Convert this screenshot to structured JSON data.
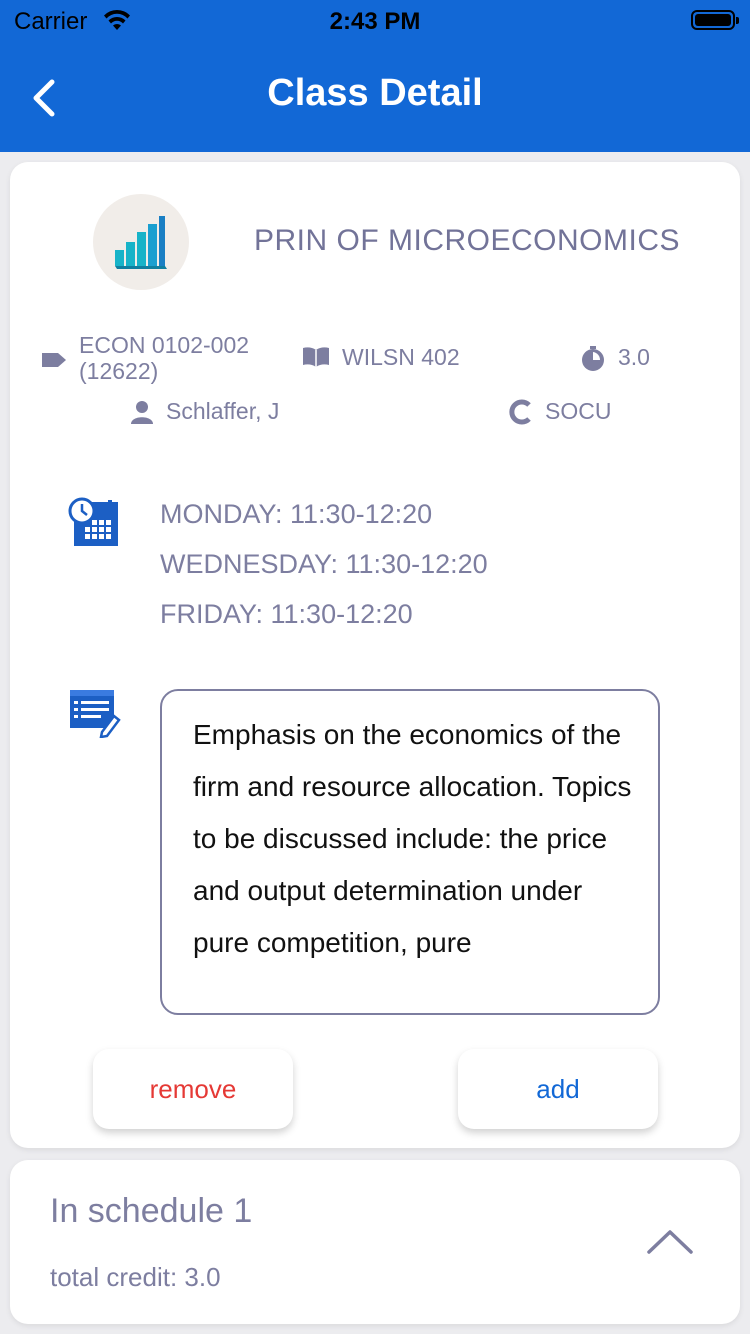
{
  "status_bar": {
    "carrier": "Carrier",
    "time": "2:43 PM"
  },
  "nav": {
    "title": "Class Detail",
    "back_icon": "chevron-left-icon"
  },
  "course": {
    "title": "PRIN OF MICROECONOMICS",
    "code": "ECON 0102-002",
    "class_number": "(12622)",
    "room": "WILSN 402",
    "credits": "3.0",
    "instructor": "Schlaffer, J",
    "campus": "SOCU"
  },
  "schedule": [
    "MONDAY:  11:30-12:20",
    "WEDNESDAY:  11:30-12:20",
    "FRIDAY:  11:30-12:20"
  ],
  "description": "Emphasis on the economics of the firm and resource allocation. Topics to be discussed include: the price and output determination under pure competition, pure",
  "buttons": {
    "remove": "remove",
    "add": "add"
  },
  "schedule_summary": {
    "title": "In schedule 1",
    "total_credit": "total credit: 3.0"
  },
  "colors": {
    "header": "#1268d6",
    "remove": "#e53935",
    "add": "#1268d6",
    "muted_text": "#7d7ea0"
  }
}
